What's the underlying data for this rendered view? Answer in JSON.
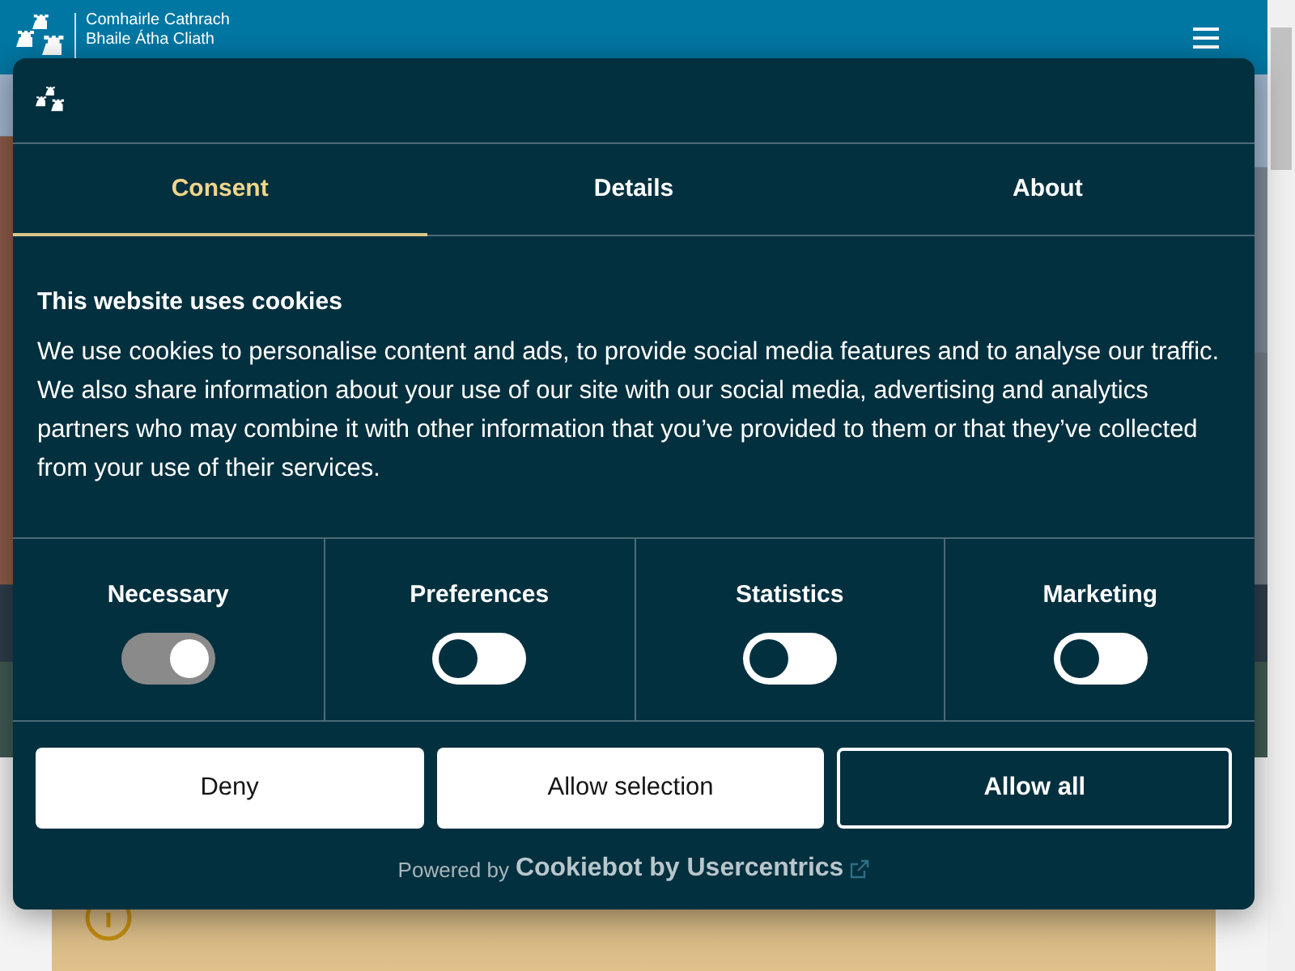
{
  "header": {
    "logo_lines": [
      "Comhairle Cathrach",
      "Bhaile Átha Cliath"
    ]
  },
  "dialog": {
    "tabs": [
      {
        "label": "Consent",
        "selected": true
      },
      {
        "label": "Details",
        "selected": false
      },
      {
        "label": "About",
        "selected": false
      }
    ],
    "title": "This website uses cookies",
    "text": "We use cookies to personalise content and ads, to provide social media features and to analyse our traffic. We also share information about your use of our site with our social media, advertising and analytics partners who may combine it with other information that you’ve provided to them or that they’ve collected from your use of their services.",
    "categories": [
      {
        "label": "Necessary",
        "checked": true,
        "disabled": true
      },
      {
        "label": "Preferences",
        "checked": false,
        "disabled": false
      },
      {
        "label": "Statistics",
        "checked": false,
        "disabled": false
      },
      {
        "label": "Marketing",
        "checked": false,
        "disabled": false
      }
    ],
    "buttons": [
      {
        "label": "Deny",
        "kind": "light"
      },
      {
        "label": "Allow selection",
        "kind": "light"
      },
      {
        "label": "Allow all",
        "kind": "dark"
      }
    ],
    "powered_by": {
      "prefix": "Powered by",
      "brand": "Cookiebot by Usercentrics"
    }
  }
}
